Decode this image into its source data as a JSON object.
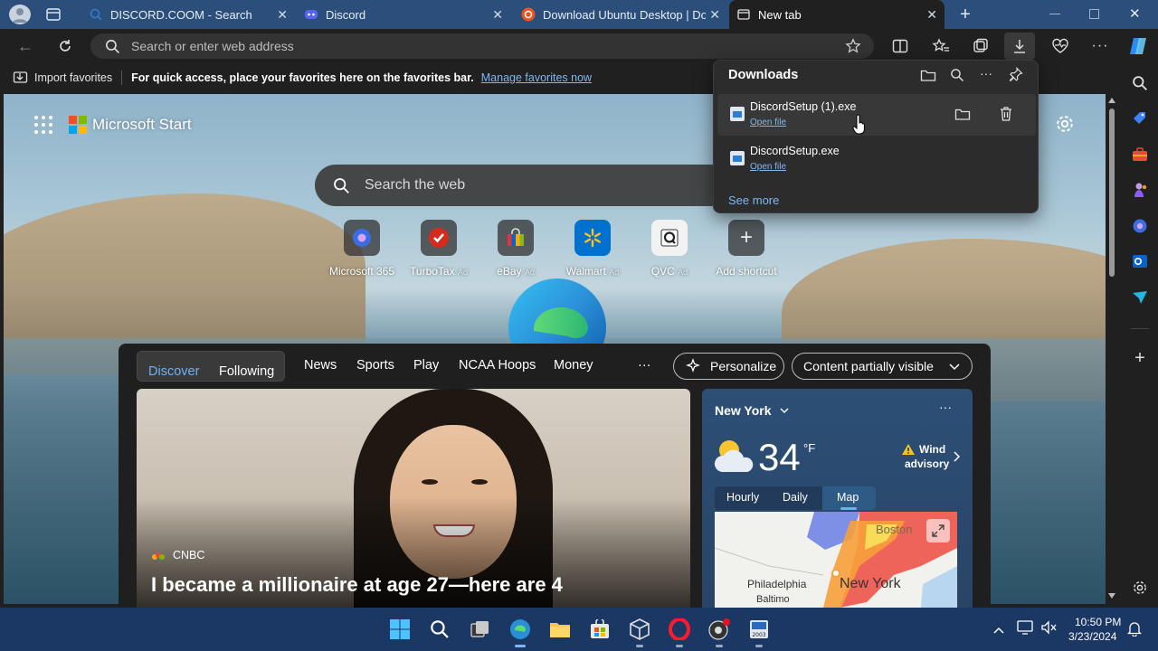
{
  "tabs": [
    {
      "title": "DISCORD.COOM - Search"
    },
    {
      "title": "Discord"
    },
    {
      "title": "Download Ubuntu Desktop | Do"
    },
    {
      "title": "New tab"
    }
  ],
  "address": {
    "placeholder": "Search or enter web address"
  },
  "favorites": {
    "import": "Import favorites",
    "hint": "For quick access, place your favorites here on the favorites bar.",
    "manage": "Manage favorites now"
  },
  "brand": {
    "name": "Microsoft Start"
  },
  "websearch": {
    "placeholder": "Search the web"
  },
  "shortcuts": [
    {
      "label": "Microsoft 365",
      "ad": ""
    },
    {
      "label": "TurboTax",
      "ad": "Ad"
    },
    {
      "label": "eBay",
      "ad": "Ad"
    },
    {
      "label": "Walmart",
      "ad": "Ad"
    },
    {
      "label": "QVC",
      "ad": "Ad"
    },
    {
      "label": "Add shortcut",
      "ad": ""
    }
  ],
  "feed": {
    "tabs": [
      "Discover",
      "Following",
      "News",
      "Sports",
      "Play",
      "NCAA Hoops",
      "Money"
    ],
    "more": "···",
    "personalize": "Personalize",
    "visibility": "Content partially visible"
  },
  "hero": {
    "source": "CNBC",
    "headline": "I became a millionaire at age 27—here are 4"
  },
  "weather": {
    "city": "New York",
    "temp": "34",
    "unit": "°F",
    "alert_line1": "Wind",
    "alert_line2": "advisory",
    "tabs": [
      "Hourly",
      "Daily",
      "Map"
    ],
    "map_labels": {
      "boston": "Boston",
      "philadelphia": "Philadelphia",
      "baltimore": "Baltimo",
      "newyork": "New York"
    }
  },
  "downloads": {
    "title": "Downloads",
    "items": [
      {
        "name": "DiscordSetup (1).exe",
        "action": "Open file"
      },
      {
        "name": "DiscordSetup.exe",
        "action": "Open file"
      }
    ],
    "see_more": "See more"
  },
  "clock": {
    "time": "10:50 PM",
    "date": "3/23/2024"
  },
  "colors": {
    "accent": "#2f7dd1",
    "taskbar": "#1b3764",
    "tabstrip": "#2b4f7a"
  }
}
